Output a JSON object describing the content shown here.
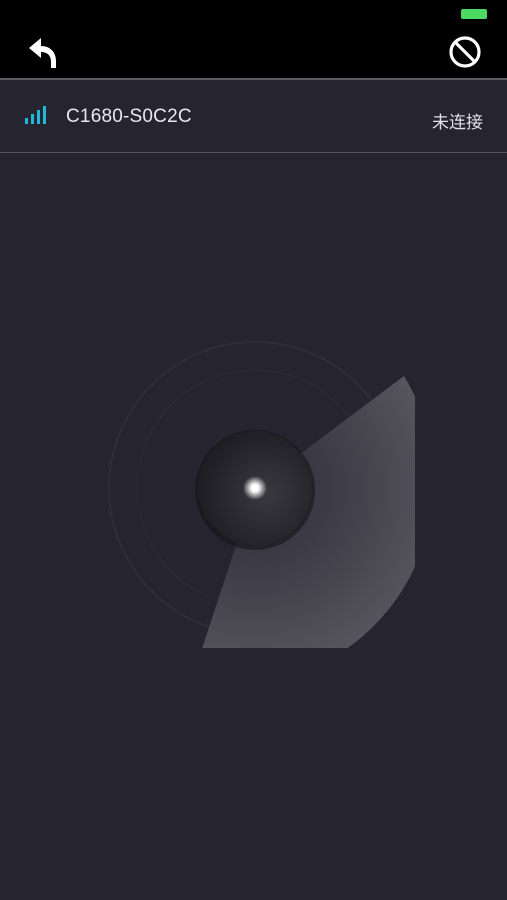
{
  "status_bar": {
    "battery_color": "#4cd964"
  },
  "navbar": {
    "back_icon": "back-arrow-icon",
    "block_icon": "no-entry-icon"
  },
  "device": {
    "signal_icon": "signal-bars-icon",
    "signal_color": "#1fb8d6",
    "name": "C1680-S0C2C",
    "status": "未连接"
  },
  "scanner": {
    "icon": "radar-scan-icon"
  }
}
